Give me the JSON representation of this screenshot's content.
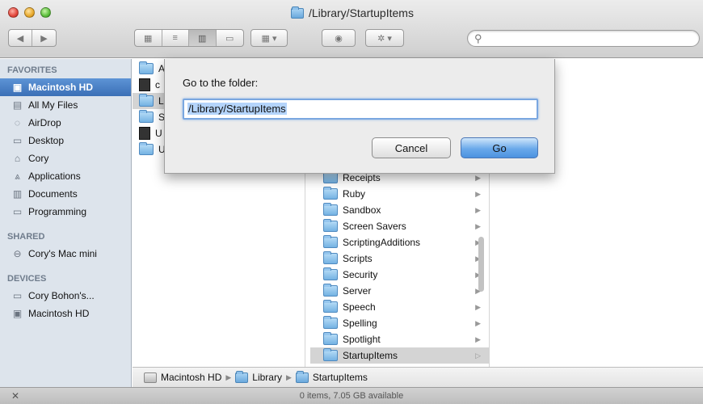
{
  "window": {
    "title": "/Library/StartupItems"
  },
  "toolbar": {
    "back_label": "◀",
    "forward_label": "▶",
    "view_icon_label": "▦",
    "view_list_label": "≡",
    "view_column_label": "▥",
    "view_coverflow_label": "▭",
    "arrange_label": "▦ ▾",
    "quicklook_label": "◉",
    "action_label": "✲ ▾",
    "search_placeholder": ""
  },
  "sidebar": {
    "favorites_header": "FAVORITES",
    "favorites": [
      {
        "label": "Macintosh HD",
        "icon": "hd-icon",
        "glyph": "▣"
      },
      {
        "label": "All My Files",
        "icon": "all-files-icon",
        "glyph": "▤"
      },
      {
        "label": "AirDrop",
        "icon": "airdrop-icon",
        "glyph": "◌"
      },
      {
        "label": "Desktop",
        "icon": "desktop-icon",
        "glyph": "▭"
      },
      {
        "label": "Cory",
        "icon": "home-icon",
        "glyph": "⌂"
      },
      {
        "label": "Applications",
        "icon": "applications-icon",
        "glyph": "⩓"
      },
      {
        "label": "Documents",
        "icon": "documents-icon",
        "glyph": "▥"
      },
      {
        "label": "Programming",
        "icon": "folder-icon",
        "glyph": "▭"
      }
    ],
    "shared_header": "SHARED",
    "shared": [
      {
        "label": "Cory's Mac mini",
        "icon": "network-computer-icon",
        "glyph": "⊖"
      }
    ],
    "devices_header": "DEVICES",
    "devices": [
      {
        "label": "Cory Bohon's...",
        "icon": "laptop-icon",
        "glyph": "▭"
      },
      {
        "label": "Macintosh HD",
        "icon": "disk-icon",
        "glyph": "▣"
      }
    ]
  },
  "column1": {
    "rows": [
      {
        "label": "A",
        "kind": "folder"
      },
      {
        "label": "c",
        "kind": "doc"
      },
      {
        "label": "L",
        "kind": "folder"
      },
      {
        "label": "S",
        "kind": "folder"
      },
      {
        "label": "U",
        "kind": "doc"
      },
      {
        "label": "U",
        "kind": "folder"
      }
    ]
  },
  "column2": {
    "rows": [
      {
        "label": "Receipts"
      },
      {
        "label": "Ruby"
      },
      {
        "label": "Sandbox"
      },
      {
        "label": "Screen Savers"
      },
      {
        "label": "ScriptingAdditions"
      },
      {
        "label": "Scripts"
      },
      {
        "label": "Security"
      },
      {
        "label": "Server"
      },
      {
        "label": "Speech"
      },
      {
        "label": "Spelling"
      },
      {
        "label": "Spotlight"
      },
      {
        "label": "StartupItems"
      }
    ]
  },
  "sheet": {
    "prompt": "Go to the folder:",
    "input_value": "/Library/StartupItems",
    "cancel_label": "Cancel",
    "go_label": "Go"
  },
  "pathbar": {
    "items": [
      "Macintosh HD",
      "Library",
      "StartupItems"
    ]
  },
  "status": {
    "text": "0 items, 7.05 GB available"
  },
  "colors": {
    "sidebar_bg": "#dde4ec",
    "selection": "#3b6fb6",
    "go_button": "#6aa9ea"
  }
}
